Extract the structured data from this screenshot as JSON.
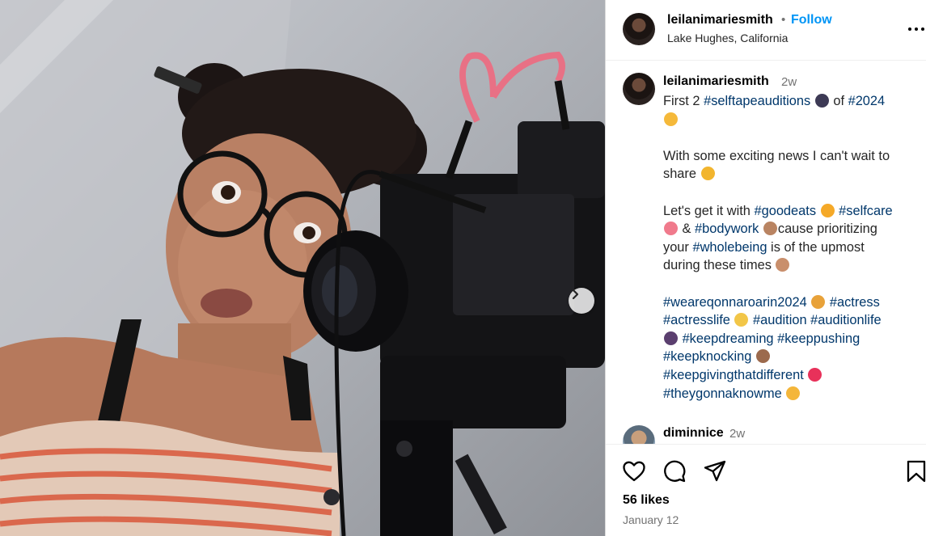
{
  "post": {
    "username": "leilanimariesmith",
    "follow_label": "Follow",
    "location": "Lake Hughes, California",
    "time_ago": "2w",
    "caption_lines": [
      {
        "parts": [
          {
            "t": "First 2 "
          },
          {
            "t": "#selftapeauditions",
            "tag": true
          },
          {
            "t": " "
          },
          {
            "e": "#3d3a55"
          },
          {
            "t": " of "
          },
          {
            "t": "#2024",
            "tag": true
          }
        ]
      },
      {
        "parts": [
          {
            "e": "#f5b93a"
          }
        ]
      },
      {
        "parts": [
          {
            "t": ""
          }
        ]
      },
      {
        "parts": [
          {
            "t": "With some exciting news I can't wait to"
          }
        ]
      },
      {
        "parts": [
          {
            "t": "share "
          },
          {
            "e": "#f2b52e"
          }
        ]
      },
      {
        "parts": [
          {
            "t": ""
          }
        ]
      },
      {
        "parts": [
          {
            "t": "Let's get it with "
          },
          {
            "t": "#goodeats",
            "tag": true
          },
          {
            "t": " "
          },
          {
            "e": "#f5a928"
          },
          {
            "t": " "
          },
          {
            "t": "#selfcare",
            "tag": true
          }
        ]
      },
      {
        "parts": [
          {
            "e": "#f07a8c"
          },
          {
            "t": " & "
          },
          {
            "t": "#bodywork",
            "tag": true
          },
          {
            "t": " "
          },
          {
            "e": "#b98462"
          },
          {
            "t": "cause prioritizing"
          }
        ]
      },
      {
        "parts": [
          {
            "t": "your "
          },
          {
            "t": "#wholebeing",
            "tag": true
          },
          {
            "t": " is of the upmost"
          }
        ]
      },
      {
        "parts": [
          {
            "t": "during these times "
          },
          {
            "e": "#c98f6c"
          }
        ]
      },
      {
        "parts": [
          {
            "t": ""
          }
        ]
      },
      {
        "parts": [
          {
            "t": "#weareqonnaroarin2024",
            "tag": true
          },
          {
            "t": " "
          },
          {
            "e": "#e8a23a"
          },
          {
            "t": " "
          },
          {
            "t": "#actress",
            "tag": true
          }
        ]
      },
      {
        "parts": [
          {
            "t": "#actresslife",
            "tag": true
          },
          {
            "t": " "
          },
          {
            "e": "#f2c648"
          },
          {
            "t": " "
          },
          {
            "t": "#audition",
            "tag": true
          },
          {
            "t": " "
          },
          {
            "t": "#auditionlife",
            "tag": true
          }
        ]
      },
      {
        "parts": [
          {
            "e": "#5b3f6f"
          },
          {
            "t": " "
          },
          {
            "t": "#keepdreaming",
            "tag": true
          },
          {
            "t": " "
          },
          {
            "t": "#keeppushing",
            "tag": true
          }
        ]
      },
      {
        "parts": [
          {
            "t": "#keepknocking",
            "tag": true
          },
          {
            "t": " "
          },
          {
            "e": "#9c6a4d"
          }
        ]
      },
      {
        "parts": [
          {
            "t": "#keepgivingthatdifferent",
            "tag": true
          },
          {
            "t": " "
          },
          {
            "e": "#e8315a"
          }
        ]
      },
      {
        "parts": [
          {
            "t": "#theygonnaknowme",
            "tag": true
          },
          {
            "t": " "
          },
          {
            "e": "#f4b63a"
          }
        ]
      }
    ]
  },
  "comment": {
    "username": "diminnice",
    "time_ago": "2w"
  },
  "stats": {
    "likes": "56 likes",
    "date": "January 12"
  },
  "icons": {
    "like": "heart-icon",
    "comment": "comment-icon",
    "share": "share-icon",
    "save": "bookmark-icon",
    "more": "more-icon",
    "next": "chevron-right-icon"
  },
  "colors": {
    "follow": "#0095f6",
    "hashtag": "#00376b",
    "muted": "#737373"
  }
}
